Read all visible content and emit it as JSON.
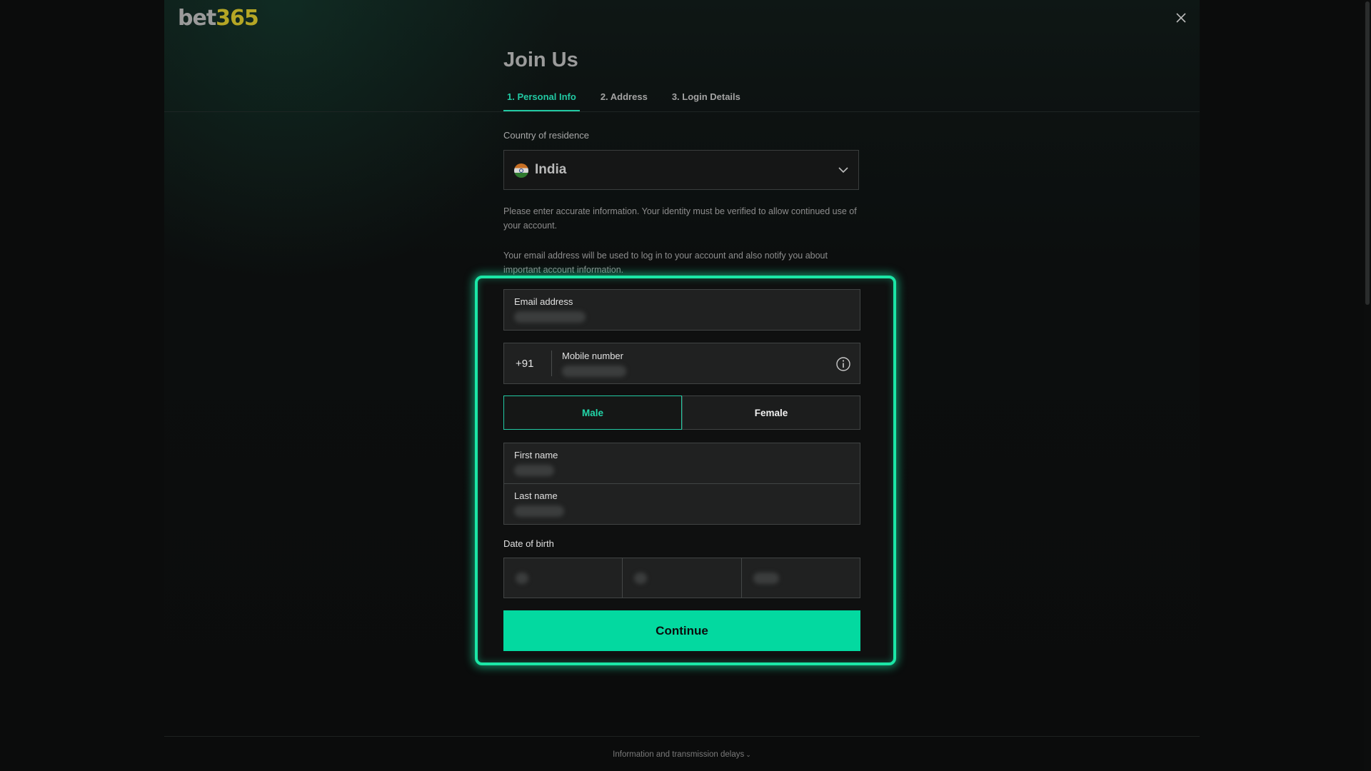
{
  "brand": {
    "logo_left": "bet",
    "logo_right": "365",
    "logo_colors": {
      "bet": "#9a9a9a",
      "num": "#b5a625"
    }
  },
  "page": {
    "title": "Join Us",
    "close_icon": "close-icon"
  },
  "steps": [
    {
      "label": "1. Personal Info",
      "active": true
    },
    {
      "label": "2. Address",
      "active": false
    },
    {
      "label": "3. Login Details",
      "active": false
    }
  ],
  "country": {
    "label": "Country of residence",
    "value": "India",
    "flag_icon": "india-flag-icon"
  },
  "info": {
    "identity": "Please enter accurate information. Your identity must be verified to allow continued use of your account.",
    "email_notice": "Your email address will be used to log in to your account and also notify you about important account information."
  },
  "form": {
    "email_label": "Email address",
    "phone_prefix": "+91",
    "mobile_label": "Mobile number",
    "gender": {
      "male": "Male",
      "female": "Female",
      "selected": "Male"
    },
    "first_name_label": "First name",
    "last_name_label": "Last name",
    "dob_label": "Date of birth",
    "continue_label": "Continue"
  },
  "footer": {
    "text": "Information and transmission delays"
  },
  "colors": {
    "accent": "#03d9a0",
    "highlight": "#1be6a6",
    "background": "#0b0c0c"
  }
}
